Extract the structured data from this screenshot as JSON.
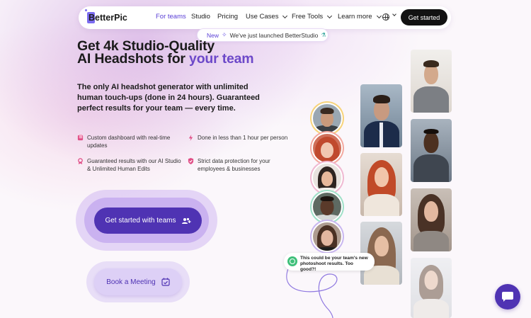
{
  "nav": {
    "logo": "BetterPic",
    "items": [
      {
        "label": "For teams",
        "active": true
      },
      {
        "label": "Studio"
      },
      {
        "label": "Pricing"
      },
      {
        "label": "Use Cases",
        "dropdown": true
      },
      {
        "label": "Free Tools",
        "dropdown": true
      },
      {
        "label": "Learn more",
        "dropdown": true
      }
    ],
    "cta": "Get started"
  },
  "announcement": {
    "tag": "New",
    "text": "We've just launched BetterStudio"
  },
  "hero": {
    "title_line1": "Get 4k Studio-Quality",
    "title_line2_prefix": "AI Headshots for ",
    "title_line2_accent": "your team",
    "subtitle": "The only AI headshot generator with unlimited human touch-ups (done in 24 hours). Guaranteed perfect results for your team — every time."
  },
  "features": [
    {
      "icon": "dashboard-icon",
      "text": "Custom dashboard with real-time updates"
    },
    {
      "icon": "lightning-icon",
      "text": "Done in less than 1 hour per person"
    },
    {
      "icon": "award-icon",
      "text": "Guaranteed results with our AI Studio & Unlimited Human Edits"
    },
    {
      "icon": "shield-icon",
      "text": "Strict data protection for your employees & businesses"
    }
  ],
  "cta_main": "Get started with teams",
  "cta_book": "Book a Meeting",
  "result_bubble": "This could be your team's new photoshoot results. Too good?!",
  "colors": {
    "accent": "#6d49c9",
    "cta": "#4f33b3",
    "nav_cta": "#121212",
    "feature_pink": "#e04e86"
  }
}
